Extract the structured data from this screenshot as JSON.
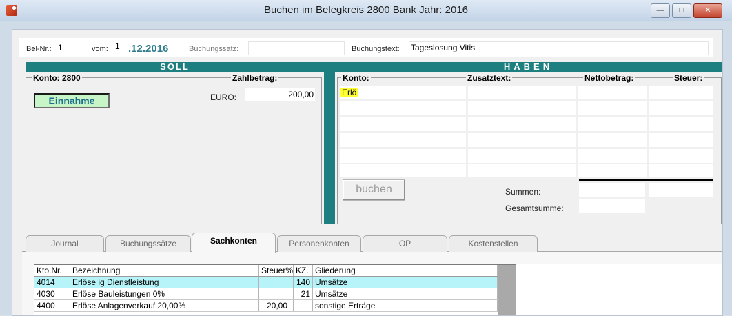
{
  "window": {
    "title": "Buchen im Belegkreis 2800 Bank Jahr: 2016"
  },
  "header": {
    "belnr_label": "Bel-Nr.:",
    "belnr_value": "1",
    "vom_label": "vom:",
    "vom_day": "1",
    "vom_rest": ".12.2016",
    "buchungssatz_label": "Buchungssatz:",
    "buchungstext_label": "Buchungstext:",
    "buchungstext_value": "Tageslosung Vitis"
  },
  "soll": {
    "title": "SOLL",
    "konto_label": "Konto: 2800",
    "zahlbetrag_label": "Zahlbetrag:",
    "typ": "Einnahme",
    "currency": "EURO:",
    "amount": "200,00"
  },
  "haben": {
    "title": "HABEN",
    "col_konto": "Konto:",
    "col_zusatztext": "Zusatztext:",
    "col_netto": "Nettobetrag:",
    "col_steuer": "Steuer:",
    "konto_input": "Erlö",
    "buchen_label": "buchen",
    "summen_label": "Summen:",
    "gesamtsumme_label": "Gesamtsumme:"
  },
  "tabs": [
    {
      "label": "Journal"
    },
    {
      "label": "Buchungssätze"
    },
    {
      "label": "Sachkonten",
      "active": true
    },
    {
      "label": "Personenkonten"
    },
    {
      "label": "OP"
    },
    {
      "label": "Kostenstellen"
    }
  ],
  "table": {
    "columns": [
      "Kto.Nr.",
      "Bezeichnung",
      "Steuer%",
      "KZ.",
      "Gliederung"
    ],
    "rows": [
      {
        "kto": "4014",
        "bez": "Erlöse ig Dienstleistung",
        "steuer": "",
        "kz": "140",
        "glied": "Umsätze",
        "selected": true
      },
      {
        "kto": "4030",
        "bez": "Erlöse Bauleistungen 0%",
        "steuer": "",
        "kz": "21",
        "glied": "Umsätze"
      },
      {
        "kto": "4400",
        "bez": "Erlöse Anlagenverkauf 20,00%",
        "steuer": "20,00",
        "kz": "",
        "glied": "sonstige Erträge"
      }
    ]
  }
}
